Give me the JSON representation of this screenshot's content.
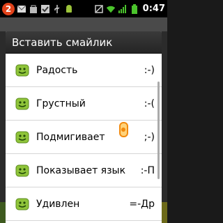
{
  "status_bar": {
    "notification_count": "2",
    "time": "0:47"
  },
  "dialog": {
    "title": "Вставить смайлик",
    "items": [
      {
        "label": "Радость",
        "code": ":-)"
      },
      {
        "label": "Грустный",
        "code": ":-("
      },
      {
        "label": "Подмигивает",
        "code": ";-)"
      },
      {
        "label": "Показывает язык",
        "code": ":-П"
      },
      {
        "label": "Удивлен",
        "code": "=-Др"
      }
    ]
  },
  "icons": [
    "smiley-icon",
    "cursor-icon"
  ],
  "colors": {
    "accent": "#e2421a",
    "smiley": "#9cc43a"
  }
}
